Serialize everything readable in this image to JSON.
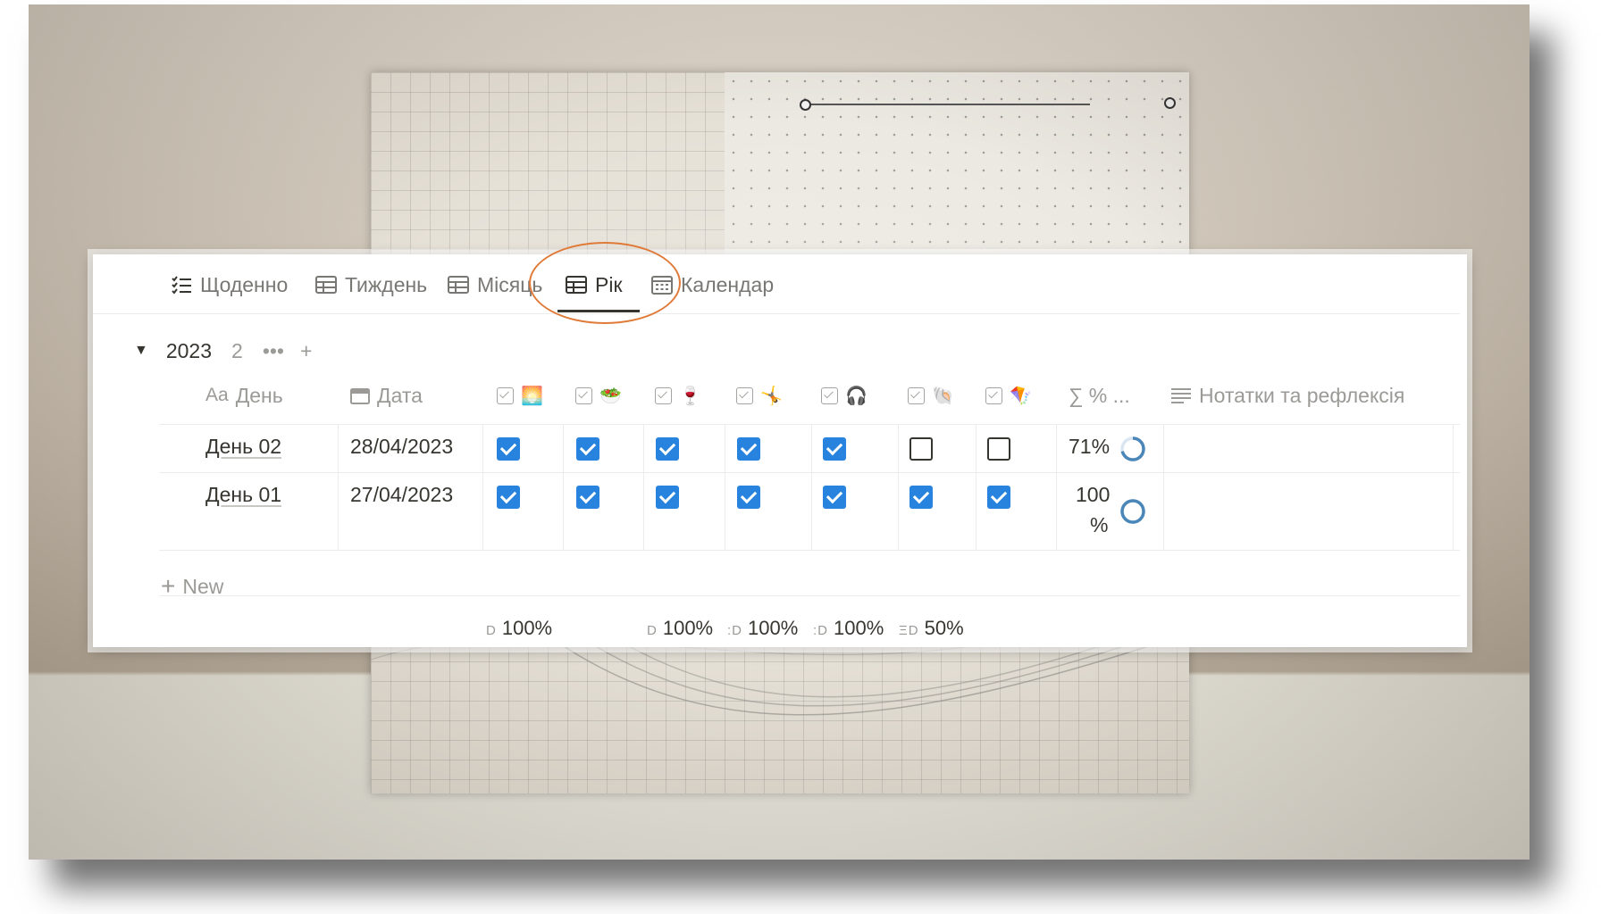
{
  "tabs": [
    {
      "label": "Щоденно",
      "icon": "checklist-icon",
      "active": false
    },
    {
      "label": "Тиждень",
      "icon": "table-icon",
      "active": false
    },
    {
      "label": "Місяць",
      "icon": "table-icon",
      "active": false
    },
    {
      "label": "Рік",
      "icon": "table-icon",
      "active": true
    },
    {
      "label": "Календар",
      "icon": "calendar-icon",
      "active": false
    }
  ],
  "group": {
    "caret": "▼",
    "title": "2023",
    "count": "2",
    "more": "•••",
    "add": "+"
  },
  "columns": {
    "day": {
      "prefix": "Aa",
      "label": "День"
    },
    "date": {
      "label": "Дата"
    },
    "habits": [
      {
        "emoji": "🌅"
      },
      {
        "emoji": "🥗"
      },
      {
        "emoji": "🍷"
      },
      {
        "emoji": "🤸"
      },
      {
        "emoji": "🎧"
      },
      {
        "emoji": "🐚"
      },
      {
        "emoji": "🪁"
      }
    ],
    "percent": {
      "label": "∑ % ..."
    },
    "notes": {
      "label": "Нотатки та рефлексія"
    }
  },
  "rows": [
    {
      "day": "День 02",
      "date": "28/04/2023",
      "checks": [
        true,
        true,
        true,
        true,
        true,
        false,
        false
      ],
      "percent": "71%",
      "progress": 0.71
    },
    {
      "day": "День 01",
      "date": "27/04/2023",
      "checks": [
        true,
        true,
        true,
        true,
        true,
        true,
        true
      ],
      "percent_line1": "100",
      "percent_line2": "%",
      "progress": 1.0
    }
  ],
  "new_label": "New",
  "calculations": [
    {
      "label": "D",
      "value": "100%"
    },
    {
      "label": "D",
      "value": "100%"
    },
    {
      "label": ":D",
      "value": "100%"
    },
    {
      "label": ":D",
      "value": "100%"
    },
    {
      "label": "ΞD",
      "value": "50%"
    }
  ],
  "colors": {
    "checkbox_checked": "#2783de",
    "highlight_circle": "#e07a38",
    "ring": "#4a86b8"
  }
}
